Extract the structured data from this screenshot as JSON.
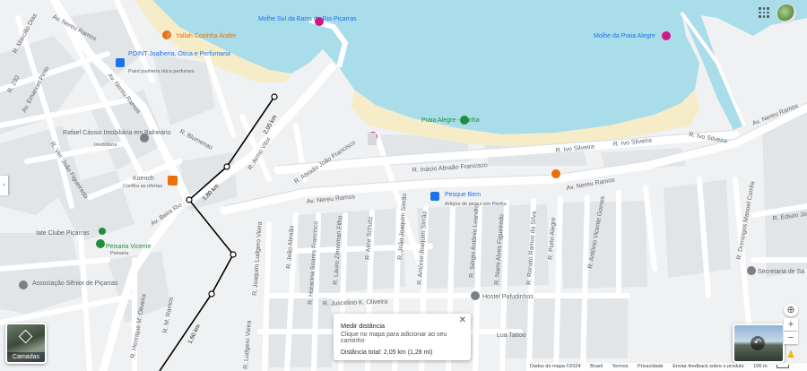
{
  "streets": {
    "av_nereu_ramos_nw": "Av. Nereu Ramos",
    "av_nereu_ramos_mid": "Av. Nereu Ramos",
    "av_nereu_ramos_e1": "Av. Nereu Ramos",
    "av_nereu_ramos_ne": "Av. Nereu Ramos",
    "r_marcilio_dias": "R. Marcílio Dias",
    "r_230": "R. 230",
    "av_emanuel_pinto": "Av. Emanuel Pinto",
    "r_blumenau": "R. Blumenau",
    "r_ver_joao_figueiredo": "R. Ver. João Figueiredo",
    "av_beira_rio": "Av. Beira Rio",
    "r_armo_vitor": "R. Armo Vitor",
    "r_abraao_joao_francisco": "R. Abraão João Francisco",
    "r_inacio_abraao_francisco": "R. Inácio Abraão Francisco",
    "r_ivo_silveira_1": "R. Ivo Silveira",
    "r_ivo_silveira_2": "R. Ivo Silveira",
    "r_ivo_silveira_3": "R. Ivo Silveira",
    "r_joaquim_ludgero_vieira": "R. Joaquim Ludgero Vieira",
    "r_joao_abraao": "R. João Abraão",
    "r_horacina_soares_francisco": "R. Horacina Soares Francisco",
    "r_lauro_zimerman_filho": "R. Lauro Zimerman Filho",
    "r_alice_schultz": "R. Alice Schultz",
    "r_joao_joaquim_simao": "R. João Joaquim Simão",
    "r_antonio_joaquim_simao": "R. Antônio Joaquim Simão",
    "r_sergio_antonio_leandro": "R. Sérgio Antônio Leandro",
    "r_nami_alves_figueiredo": "R. Nami Alves Figueiredo",
    "r_renato_ramos_da_silva": "R. Renato Ramos da Silva",
    "r_porto_alegre": "R. Porto Alegre",
    "r_juscelino_k_oliveira": "R. Juscelino K. Oliveira",
    "r_domingos_manoel_correa": "R. Domingos Manoel Corrêa",
    "r_edson_jose": "R. Edson José",
    "r_henrique_m_oliveira": "R. Henrique M. Oliveira",
    "r_m_ramos": "R. M. Ramos",
    "r_antonio_vicente_gomes": "R. Antônio Vicente Gomes",
    "r_ludgero_vieira": "R. Ludgero Vieira"
  },
  "places": {
    "molhe_sul": "Molhe Sul da Barra do Rio Piçarras",
    "molhe_praia_alegre": "Molhe da Praia Alegre",
    "yalla_cozinha": "Yallah Cozinha Árabe",
    "point_joalheria": "POINT Joalheria, Ótica e Perfumaria",
    "point_sub": "Point joalheria ótica perfumes",
    "rafael_cassio": "Rafael Cássio Imobiliária em Balneário",
    "rafael_sub": "Imobiliária",
    "praia_alegre": "Praia Alegre - Penha",
    "koench": "Koench",
    "koench_sub": "Confira as ofertas",
    "pesque_bem": "Pesque Bem",
    "pesque_sub": "Artigos de pesca em Penha",
    "iate_clube": "Iate Clube Piçarras",
    "peixaria_vicente": "Peixaria Vicente",
    "peixaria_sub": "Peixaria",
    "associacao": "Associação Sênior de Piçarras",
    "hostel": "Hostel Pafudinhos",
    "lua_tattoo": "Lua Tattoo",
    "secretaria": "Secretaria de Sa"
  },
  "measure_labels": {
    "seg1": "2,05 km",
    "seg2": "1,80 km",
    "seg3": "1,60 km"
  },
  "measure_panel": {
    "title": "Medir distância",
    "hint": "Clique no mapa para adicionar ao seu caminho",
    "total": "Distância total: 2,05 km (1,28 mi)",
    "close": "✕"
  },
  "layers": {
    "label": "Camadas"
  },
  "controls": {
    "zoom_in": "+",
    "zoom_out": "−",
    "location": "⊕"
  },
  "attribution": {
    "data": "Dados do mapa ©2024",
    "country": "Brasil",
    "terms": "Termos",
    "privacy": "Privacidade",
    "feedback": "Enviar feedback sobre o produto",
    "scale": "100 m"
  },
  "colors": {
    "water": "#a9dde9",
    "land": "#f0f1f2",
    "road": "#ffffff",
    "road_casing": "#d9dde2",
    "block": "#e2e5e8",
    "sand": "#f6ecc7",
    "label": "#5f6368",
    "poi_orange": "#e8710a",
    "poi_blue": "#1a73e8",
    "poi_pink": "#d01884",
    "poi_green": "#1e8e3e",
    "poi_gray": "#7b8088"
  }
}
